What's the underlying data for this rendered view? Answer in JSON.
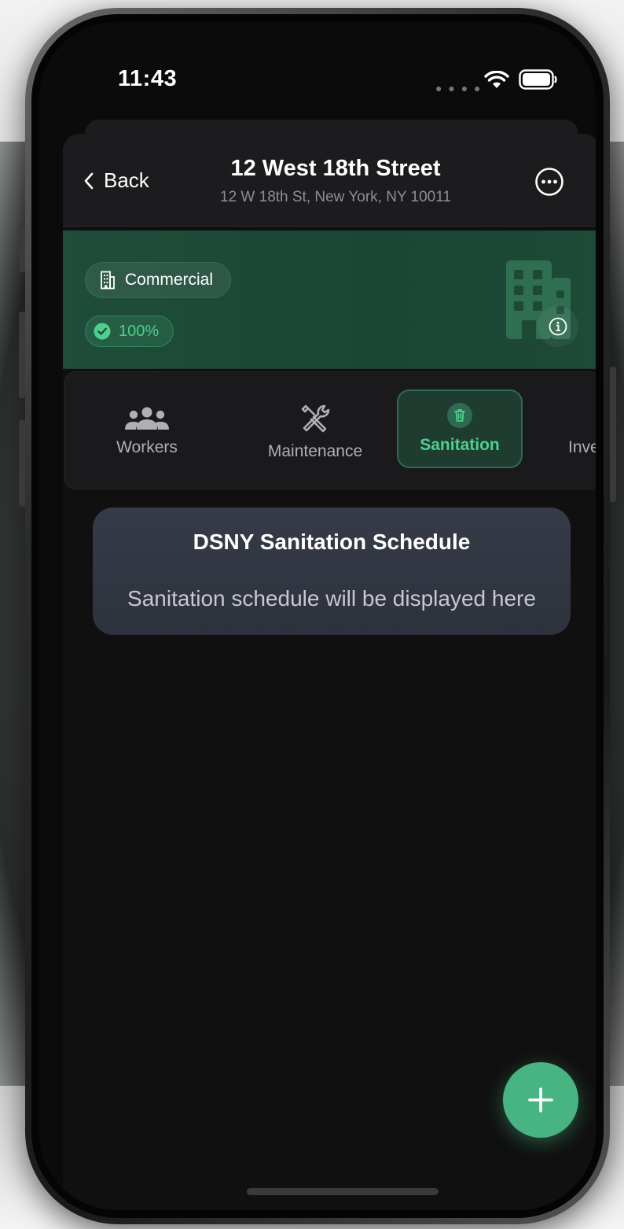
{
  "status_bar": {
    "time": "11:43",
    "signal_icon": "signal-dots-icon",
    "wifi_icon": "wifi-icon",
    "battery_icon": "battery-icon"
  },
  "header": {
    "back_label": "Back",
    "title": "12 West 18th Street",
    "subtitle": "12 W 18th St, New York, NY 10011",
    "more_icon": "ellipsis-circle-icon"
  },
  "hero": {
    "type_label": "Commercial",
    "completion_label": "100%",
    "completion_value": 100,
    "building_icon": "building-icon",
    "info_icon": "info-icon"
  },
  "tabs": [
    {
      "label": "Workers",
      "icon": "people-icon",
      "active": false
    },
    {
      "label": "Maintenance",
      "icon": "tools-icon",
      "active": false
    },
    {
      "label": "Sanitation",
      "icon": "trash-icon",
      "active": true
    },
    {
      "label": "Inve",
      "icon": "box-icon",
      "active": false
    }
  ],
  "card": {
    "title": "DSNY Sanitation Schedule",
    "body": "Sanitation schedule will be displayed here"
  },
  "fab": {
    "icon": "plus-icon"
  },
  "colors": {
    "accent": "#48b483",
    "accent_text": "#4fcf8e",
    "hero_bg": "#1f4d3a",
    "card_bg": "#363b47"
  }
}
